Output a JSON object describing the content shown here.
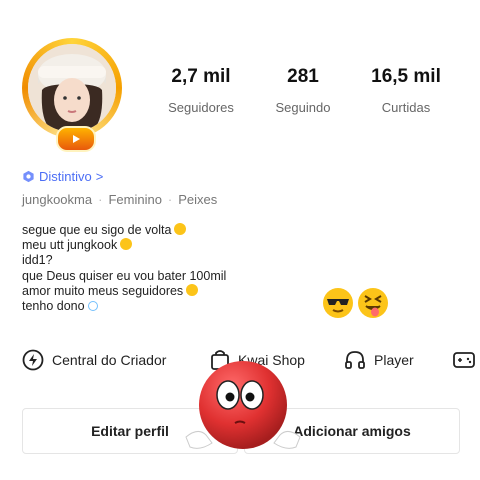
{
  "profile": {
    "stats": [
      {
        "value": "2,7 mil",
        "label": "Seguidores"
      },
      {
        "value": "281",
        "label": "Seguindo"
      },
      {
        "value": "16,5 mil",
        "label": "Curtidas"
      }
    ],
    "badge_label": "Distintivo",
    "badge_chevron": ">",
    "username": "jungkookma",
    "gender": "Feminino",
    "sign": "Peixes",
    "bio_lines": [
      "segue que eu sigo de volta",
      "meu utt jungkook",
      "idd1?",
      "que Deus quiser eu vou bater 100mil",
      "amor muito meus seguidores",
      "tenho dono"
    ]
  },
  "tools": {
    "creator_center": "Central do Criador",
    "kwai_shop": "Kwai Shop",
    "player": "Player"
  },
  "actions": {
    "edit_profile": "Editar perfil",
    "add_friends": "Adicionar amigos"
  },
  "colors": {
    "accent_blue": "#4c6ef5",
    "gold_ring": "#f59f00",
    "mascot_red": "#e03131"
  }
}
